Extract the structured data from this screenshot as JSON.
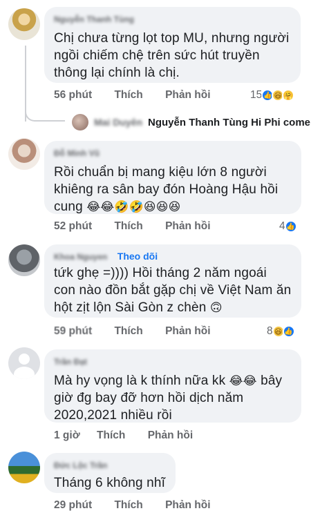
{
  "comments": [
    {
      "author": "Nguyễn Thanh Tùng",
      "text": "Chị chưa từng lọt top MU, nhưng người ngồi chiếm chệ trên sức hút truyền thông lại chính là chị.",
      "time": "56 phút",
      "like_label": "Thích",
      "reply_label": "Phản hồi",
      "reaction_count": "15",
      "reactions": [
        "like-icon",
        "haha-icon",
        "care-icon"
      ]
    },
    {
      "author": "Đỗ Minh Vũ",
      "text": "Rồi chuẩn bị mang kiệu lớn 8 người khiêng ra sân bay đón Hoàng Hậu hồi cung",
      "emojis": "😂😂🤣🤣😆😆😆",
      "time": "52 phút",
      "like_label": "Thích",
      "reply_label": "Phản hồi",
      "reaction_count": "4",
      "reactions": [
        "like-icon"
      ]
    },
    {
      "author": "Khoa Nguyen",
      "follow_label": "Theo dõi",
      "text": "tứk ghẹ =)))) Hồi tháng 2 năm ngoái con nào đồn bắt gặp chị về Việt Nam ăn hột zịt lộn Sài Gòn z chèn",
      "emojis": "🙃",
      "time": "59 phút",
      "like_label": "Thích",
      "reply_label": "Phản hồi",
      "reaction_count": "8",
      "reactions": [
        "haha-icon",
        "like-icon"
      ]
    },
    {
      "author": "Trần Đạt",
      "text_a": "Mà hy vọng là k thính nữa kk",
      "emojis": "😂😂",
      "text_b": " bây giờ đg bay đỡ hơn hồi dịch năm 2020,2021 nhiều rồi",
      "time": "1 giờ",
      "like_label": "Thích",
      "reply_label": "Phản hồi"
    },
    {
      "author": "Đức Lộc Trần",
      "text": "Tháng 6 không nhĩ",
      "time": "29 phút",
      "like_label": "Thích",
      "reply_label": "Phản hồi"
    }
  ],
  "reply_preview": {
    "author": "Mai Duyên",
    "text": "Nguyễn Thanh Tùng Hi Phi come..."
  },
  "colors": {
    "bubble": "#f0f2f5",
    "meta": "#65676b",
    "accent": "#1877f2"
  }
}
